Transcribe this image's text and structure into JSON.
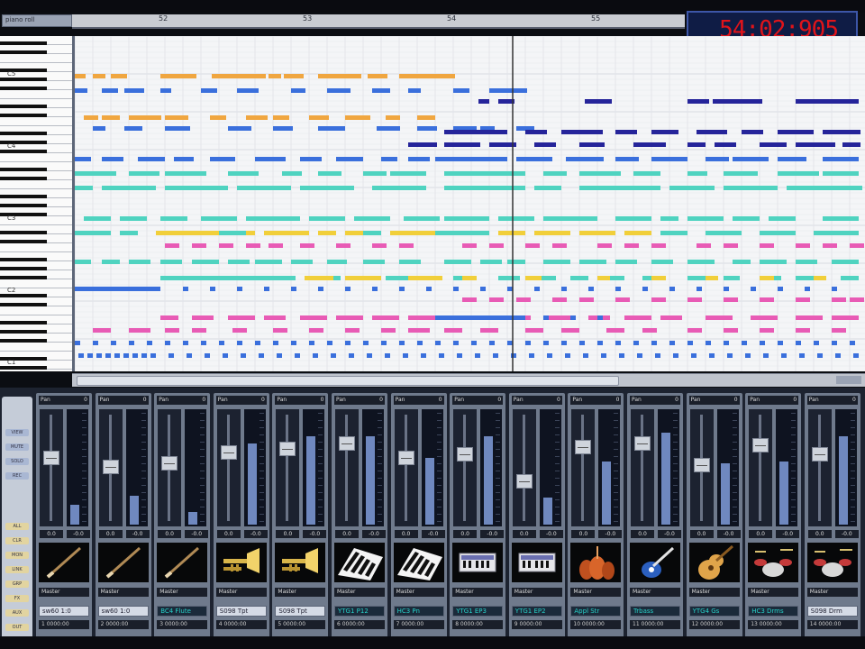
{
  "window": {
    "title": "piano roll"
  },
  "ruler": {
    "bars": [
      "52",
      "53",
      "54",
      "55"
    ]
  },
  "time_display": "54:02:905",
  "keyboard": {
    "octave_labels": [
      "C5",
      "C4",
      "C3",
      "C2",
      "C1"
    ]
  },
  "colors": {
    "orange": "#f0a640",
    "blue": "#3a6fdc",
    "navy": "#25249a",
    "teal": "#4fd3c0",
    "yellow": "#f1cf3a",
    "magenta": "#e85bb5",
    "playhead": "#333333"
  },
  "mixer": {
    "side_buttons": [
      "VIEW",
      "MUTE",
      "SOLO",
      "REC",
      "ALL",
      "CLR",
      "MON",
      "LINK",
      "GRP",
      "FX",
      "AUX",
      "OUT"
    ],
    "channels": [
      {
        "pan_left": "Pan",
        "pan_right": "0",
        "vol": "0.0",
        "peak": "-0.0",
        "icon": "baton-icon",
        "out": "Master",
        "instrument": "sw60 1:0",
        "highlight": false,
        "foot": "1 0000:00"
      },
      {
        "pan_left": "Pan",
        "pan_right": "0",
        "vol": "0.0",
        "peak": "-0.0",
        "icon": "baton-icon",
        "out": "Master",
        "instrument": "sw60 1:0",
        "highlight": false,
        "foot": "2 0000:00"
      },
      {
        "pan_left": "Pan",
        "pan_right": "0",
        "vol": "0.0",
        "peak": "-0.0",
        "icon": "baton-icon",
        "out": "Master",
        "instrument": "BC4 Flute",
        "highlight": true,
        "foot": "3 0000:00"
      },
      {
        "pan_left": "Pan",
        "pan_right": "0",
        "vol": "0.0",
        "peak": "-0.0",
        "icon": "trumpet-icon",
        "out": "Master",
        "instrument": "S098 Tpt",
        "highlight": false,
        "foot": "4 0000:00"
      },
      {
        "pan_left": "Pan",
        "pan_right": "0",
        "vol": "0.0",
        "peak": "-0.0",
        "icon": "trumpet-icon",
        "out": "Master",
        "instrument": "S098 Tpt",
        "highlight": false,
        "foot": "5 0000:00"
      },
      {
        "pan_left": "Pan",
        "pan_right": "0",
        "vol": "0.0",
        "peak": "-0.0",
        "icon": "piano-icon",
        "out": "Master",
        "instrument": "YTG1 P12",
        "highlight": true,
        "foot": "6 0000:00"
      },
      {
        "pan_left": "Pan",
        "pan_right": "0",
        "vol": "0.0",
        "peak": "-0.0",
        "icon": "piano-icon",
        "out": "Master",
        "instrument": "HC3 Pn",
        "highlight": true,
        "foot": "7 0000:00"
      },
      {
        "pan_left": "Pan",
        "pan_right": "0",
        "vol": "0.0",
        "peak": "-0.0",
        "icon": "keyboard-icon",
        "out": "Master",
        "instrument": "YTG1 EP3",
        "highlight": true,
        "foot": "8 0000:00"
      },
      {
        "pan_left": "Pan",
        "pan_right": "0",
        "vol": "0.0",
        "peak": "-0.0",
        "icon": "keyboard-icon",
        "out": "Master",
        "instrument": "YTG1 EP2",
        "highlight": true,
        "foot": "9 0000:00"
      },
      {
        "pan_left": "Pan",
        "pan_right": "0",
        "vol": "0.0",
        "peak": "-0.0",
        "icon": "strings-icon",
        "out": "Master",
        "instrument": "Appl Str",
        "highlight": true,
        "foot": "10 0000:00"
      },
      {
        "pan_left": "Pan",
        "pan_right": "0",
        "vol": "0.0",
        "peak": "-0.0",
        "icon": "bass-guitar-icon",
        "out": "Master",
        "instrument": "Trbass",
        "highlight": true,
        "foot": "11 0000:00"
      },
      {
        "pan_left": "Pan",
        "pan_right": "0",
        "vol": "0.0",
        "peak": "-0.0",
        "icon": "acoustic-guitar-icon",
        "out": "Master",
        "instrument": "YTG4 Gs",
        "highlight": true,
        "foot": "12 0000:00"
      },
      {
        "pan_left": "Pan",
        "pan_right": "0",
        "vol": "0.0",
        "peak": "-0.0",
        "icon": "drum-kit-icon",
        "out": "Master",
        "instrument": "HC3 Drms",
        "highlight": true,
        "foot": "13 0000:00"
      },
      {
        "pan_left": "Pan",
        "pan_right": "0",
        "vol": "0.0",
        "peak": "-0.0",
        "icon": "drum-kit-icon",
        "out": "Master",
        "instrument": "S098 Drm",
        "highlight": false,
        "foot": "14 0000:00"
      }
    ]
  }
}
